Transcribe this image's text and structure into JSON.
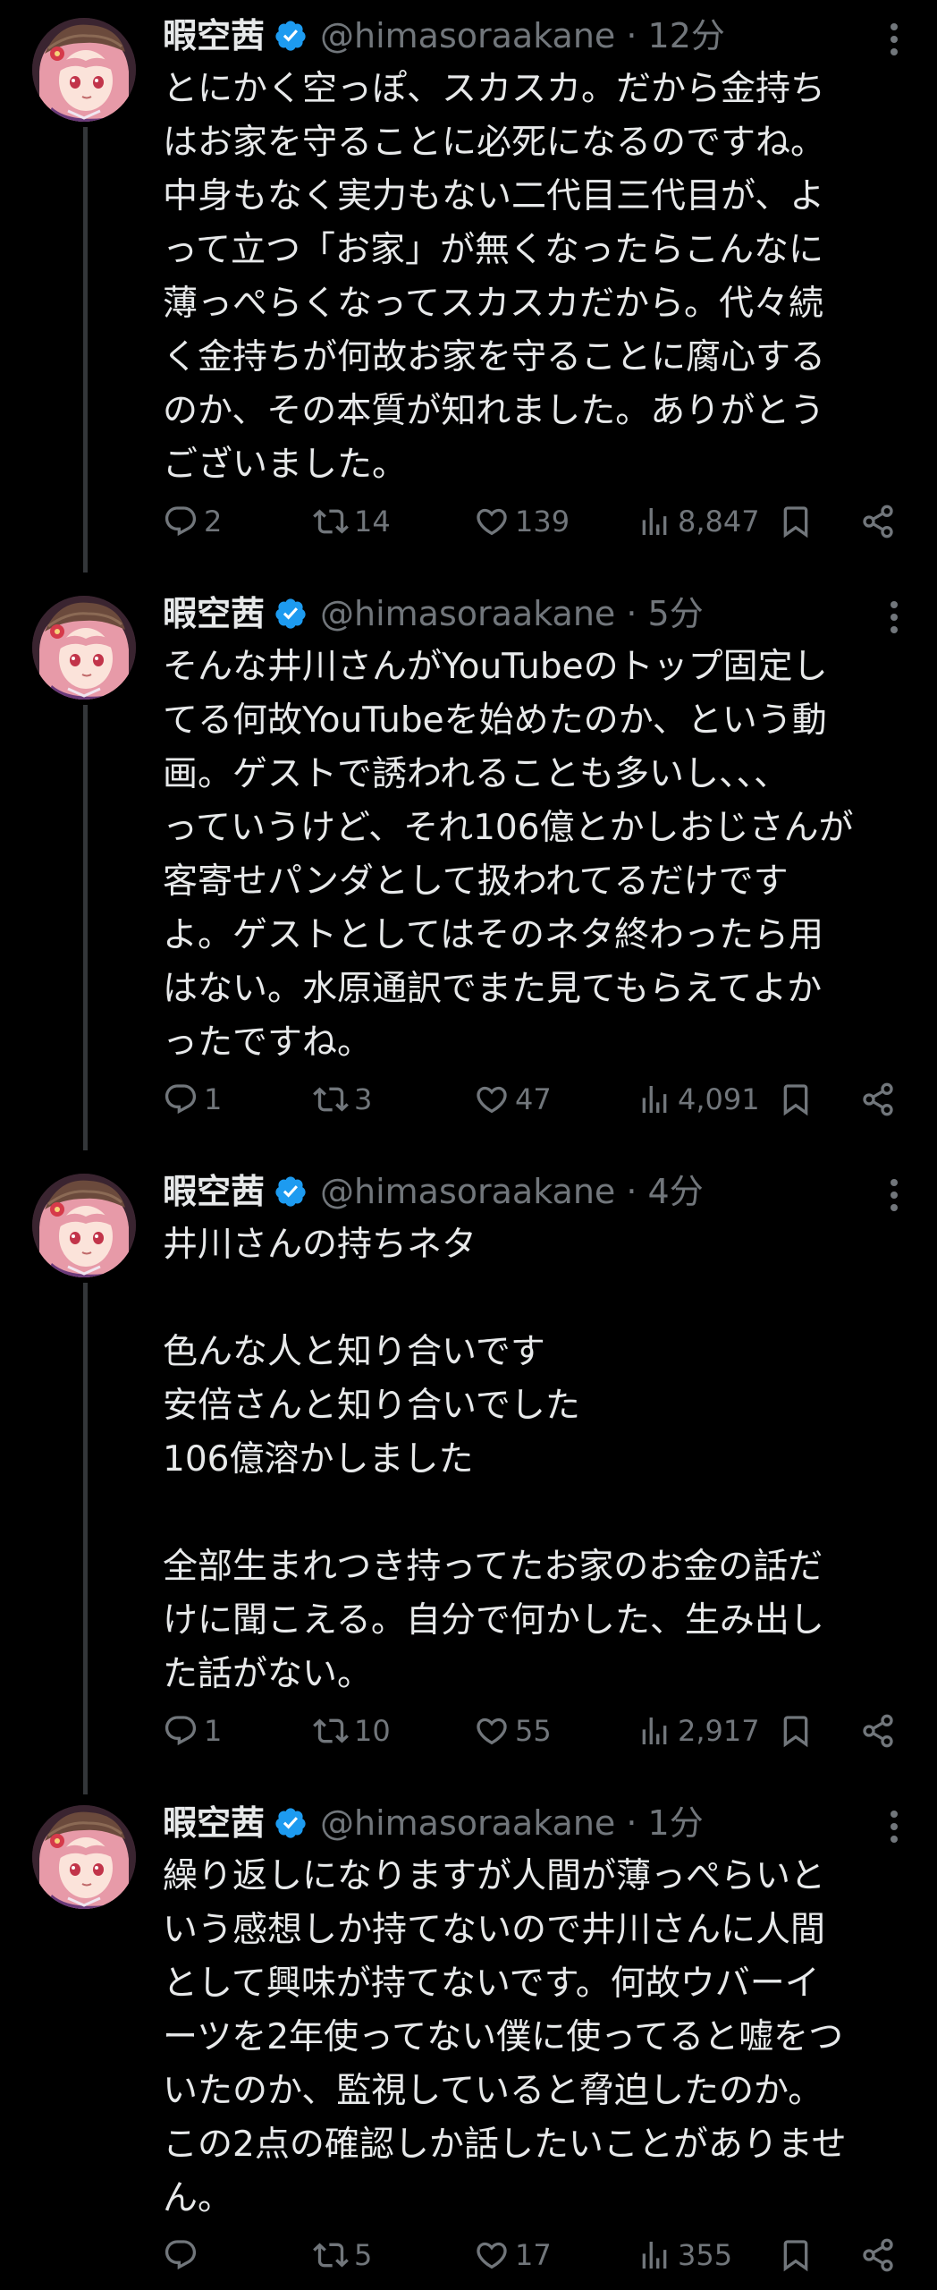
{
  "tweets": [
    {
      "name": "暇空茜",
      "handle": "@himasoraakane",
      "time": "12分",
      "lines": [
        "とにかく空っぽ、スカスカ。だから金持ち",
        "はお家を守ることに必死になるのですね。",
        "中身もなく実力もない二代目三代目が、よ",
        "って立つ「お家」が無くなったらこんなに",
        "薄っぺらくなってスカスカだから。代々続",
        "く金持ちが何故お家を守ることに腐心する",
        "のか、その本質が知れました。ありがとう",
        "ございました。"
      ],
      "replies": "2",
      "reposts": "14",
      "likes": "139",
      "views": "8,847"
    },
    {
      "name": "暇空茜",
      "handle": "@himasoraakane",
      "time": "5分",
      "lines": [
        "そんな井川さんがYouTubeのトップ固定し",
        "てる何故YouTubeを始めたのか、という動",
        "画。ゲストで誘われることも多いし、、、",
        "っていうけど、それ106億とかしおじさんが",
        "客寄せパンダとして扱われてるだけです",
        "よ。ゲストとしてはそのネタ終わったら用",
        "はない。水原通訳でまた見てもらえてよか",
        "ったですね。"
      ],
      "replies": "1",
      "reposts": "3",
      "likes": "47",
      "views": "4,091"
    },
    {
      "name": "暇空茜",
      "handle": "@himasoraakane",
      "time": "4分",
      "lines": [
        "井川さんの持ちネタ",
        "",
        "色んな人と知り合いです",
        "安倍さんと知り合いでした",
        "106億溶かしました",
        "",
        "全部生まれつき持ってたお家のお金の話だ",
        "けに聞こえる。自分で何かした、生み出し",
        "た話がない。"
      ],
      "replies": "1",
      "reposts": "10",
      "likes": "55",
      "views": "2,917"
    },
    {
      "name": "暇空茜",
      "handle": "@himasoraakane",
      "time": "1分",
      "lines": [
        "繰り返しになりますが人間が薄っぺらいと",
        "いう感想しか持てないので井川さんに人間",
        "として興味が持てないです。何故ウバーイ",
        "ーツを2年使ってない僕に使ってると嘘をつ",
        "いたのか、監視していると脅迫したのか。",
        "この2点の確認しか話したいことがありませ",
        "ん。"
      ],
      "replies": "",
      "reposts": "5",
      "likes": "17",
      "views": "355"
    }
  ],
  "colors": {
    "background": "#000000",
    "text": "#e7e9ea",
    "muted": "#71767b",
    "verified": "#1d9bf0",
    "thread_line": "#333639"
  },
  "icons": {
    "verified": "verified-badge-icon",
    "more": "more-dots-icon",
    "reply": "reply-icon",
    "repost": "repost-icon",
    "like": "heart-icon",
    "views": "views-bar-chart-icon",
    "bookmark": "bookmark-icon",
    "share": "share-icon"
  }
}
